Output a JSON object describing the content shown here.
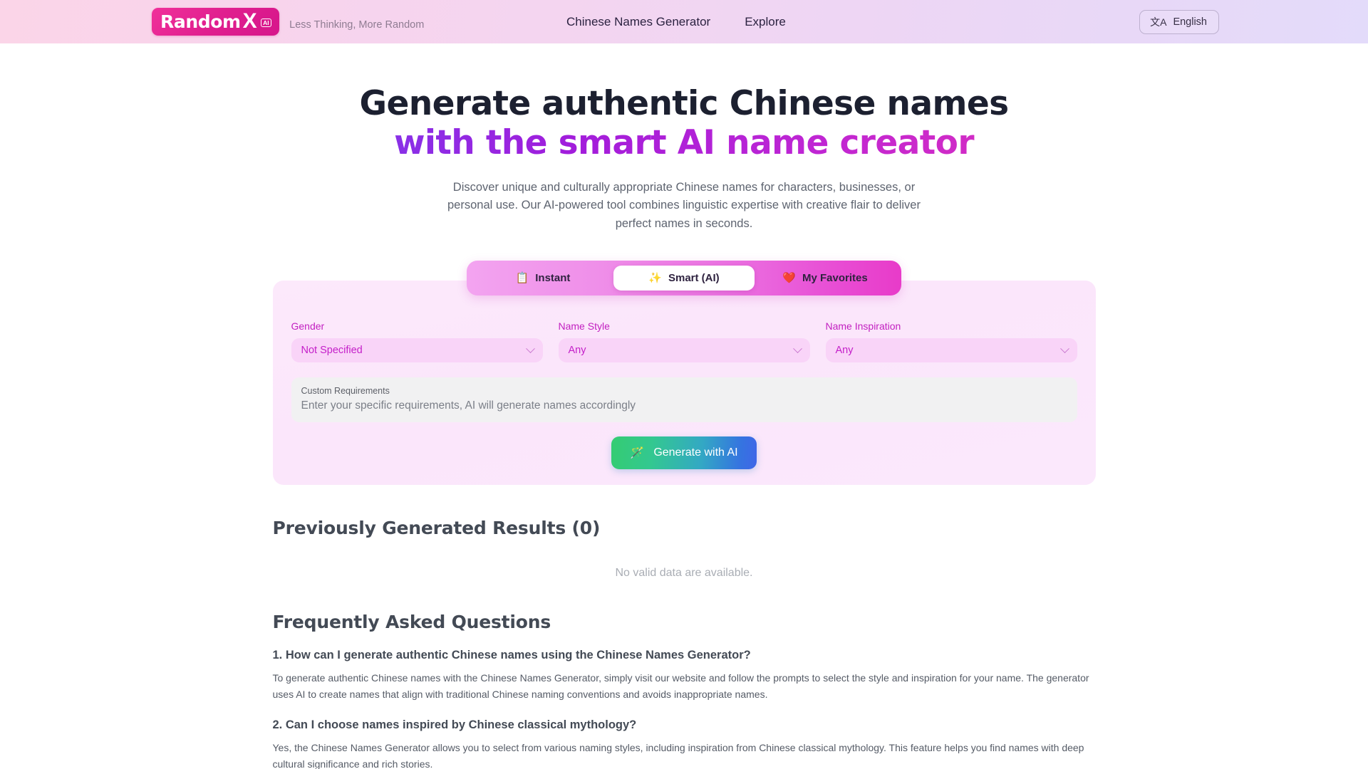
{
  "header": {
    "logo": {
      "text": "Random",
      "x": "X",
      "badge": "AI"
    },
    "tagline": "Less Thinking, More Random",
    "nav": [
      {
        "label": "Chinese Names Generator"
      },
      {
        "label": "Explore"
      }
    ],
    "language": {
      "label": "English",
      "icon": "文A"
    }
  },
  "hero": {
    "heading_line1": "Generate authentic Chinese names",
    "heading_line2": "with the smart AI name creator",
    "subtitle": "Discover unique and culturally appropriate Chinese names for characters, businesses, or personal use. Our AI-powered tool combines linguistic expertise with creative flair to deliver perfect names in seconds."
  },
  "tabs": [
    {
      "label": "Instant",
      "emoji": "📋",
      "icon_name": "clipboard-icon",
      "active": false
    },
    {
      "label": "Smart (AI)",
      "emoji": "✨",
      "icon_name": "sparkles-icon",
      "active": true
    },
    {
      "label": "My Favorites",
      "emoji": "❤️",
      "icon_name": "heart-icon",
      "active": false
    }
  ],
  "form": {
    "gender": {
      "label": "Gender",
      "value": "Not Specified"
    },
    "name_style": {
      "label": "Name Style",
      "value": "Any"
    },
    "name_inspiration": {
      "label": "Name Inspiration",
      "value": "Any"
    },
    "custom_requirements": {
      "label": "Custom Requirements",
      "placeholder": "Enter your specific requirements, AI will generate names accordingly",
      "value": ""
    },
    "generate_button": {
      "label": "Generate with AI",
      "emoji": "🪄",
      "icon_name": "magic-wand-icon"
    }
  },
  "results": {
    "title": "Previously Generated Results (0)",
    "count": 0,
    "empty_message": "No valid data are available."
  },
  "faq": {
    "title": "Frequently Asked Questions",
    "items": [
      {
        "question": "1. How can I generate authentic Chinese names using the Chinese Names Generator?",
        "answer": "To generate authentic Chinese names with the Chinese Names Generator, simply visit our website and follow the prompts to select the style and inspiration for your name. The generator uses AI to create names that align with traditional Chinese naming conventions and avoids inappropriate names."
      },
      {
        "question": "2. Can I choose names inspired by Chinese classical mythology?",
        "answer": "Yes, the Chinese Names Generator allows you to select from various naming styles, including inspiration from Chinese classical mythology. This feature helps you find names with deep cultural significance and rich stories."
      }
    ]
  },
  "colors": {
    "brand_pink": "#e01f8f",
    "accent_magenta": "#c21fc0",
    "heading_dark": "#1c2030",
    "tab_active_bg": "#ffffff",
    "generate_gradient_start": "#34cc72",
    "generate_gradient_end": "#3f66e8"
  }
}
